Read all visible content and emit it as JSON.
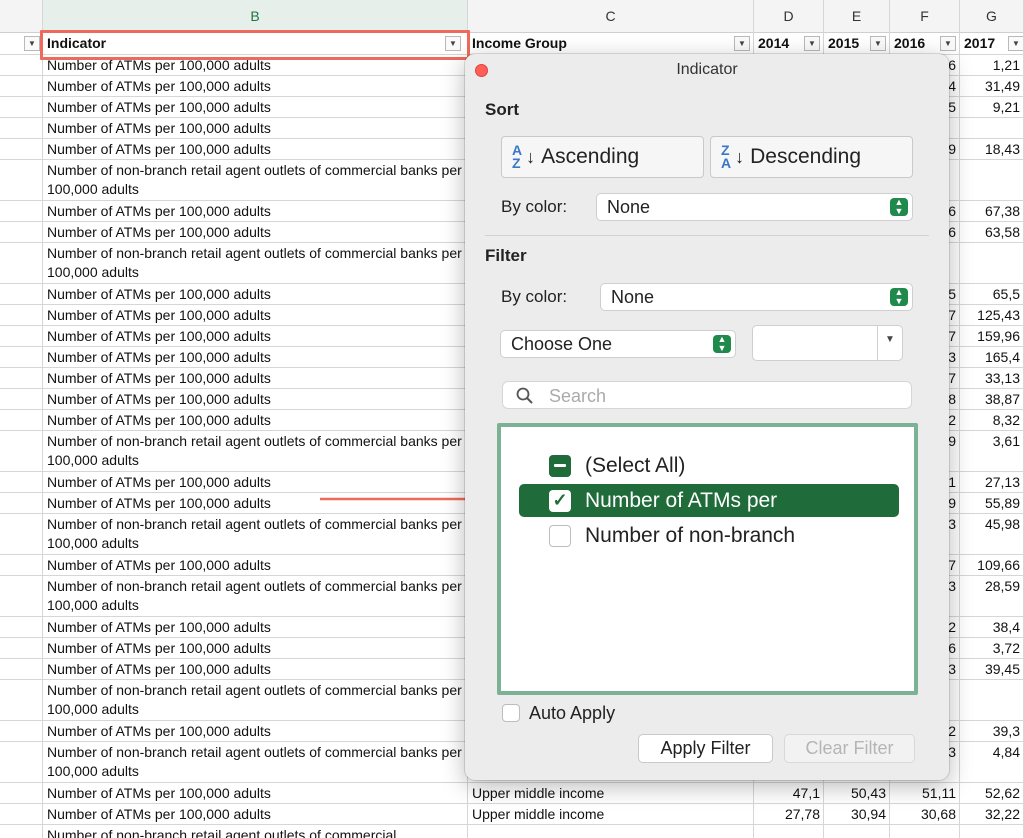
{
  "columns": {
    "b": "B",
    "c": "C",
    "d": "D",
    "e": "E",
    "f": "F",
    "g": "G"
  },
  "headers": {
    "indicator": "Indicator",
    "income_group": "Income Group",
    "y2014": "2014",
    "y2015": "2015",
    "y2016": "2016",
    "y2017": "2017"
  },
  "rows": [
    {
      "b": "Number of ATMs per 100,000 adults",
      "f": "6",
      "g": "1,21"
    },
    {
      "b": "Number of ATMs per 100,000 adults",
      "f": "4",
      "g": "31,49"
    },
    {
      "b": "Number of ATMs per 100,000 adults",
      "f": "5",
      "g": "9,21"
    },
    {
      "b": "Number of ATMs per 100,000 adults",
      "f": "",
      "g": ""
    },
    {
      "b": "Number of ATMs per 100,000 adults",
      "f": "9",
      "g": "18,43"
    },
    {
      "b": "Number of non-branch retail agent outlets of commercial banks per 100,000 adults",
      "f": "",
      "g": ""
    },
    {
      "b": "Number of ATMs per 100,000 adults",
      "f": "6",
      "g": "67,38"
    },
    {
      "b": "Number of ATMs per 100,000 adults",
      "f": "6",
      "g": "63,58"
    },
    {
      "b": "Number of non-branch retail agent outlets of commercial banks per 100,000 adults",
      "f": "",
      "g": ""
    },
    {
      "b": "Number of ATMs per 100,000 adults",
      "f": "5",
      "g": "65,5"
    },
    {
      "b": "Number of ATMs per 100,000 adults",
      "f": "7",
      "g": "125,43"
    },
    {
      "b": "Number of ATMs per 100,000 adults",
      "f": "7",
      "g": "159,96"
    },
    {
      "b": "Number of ATMs per 100,000 adults",
      "f": "3",
      "g": "165,4"
    },
    {
      "b": "Number of ATMs per 100,000 adults",
      "f": "7",
      "g": "33,13"
    },
    {
      "b": "Number of ATMs per 100,000 adults",
      "f": "8",
      "g": "38,87"
    },
    {
      "b": "Number of ATMs per 100,000 adults",
      "f": "2",
      "g": "8,32"
    },
    {
      "b": "Number of non-branch retail agent outlets of commercial banks per 100,000 adults",
      "f": "9",
      "g": "3,61"
    },
    {
      "b": "Number of ATMs per 100,000 adults",
      "f": "1",
      "g": "27,13"
    },
    {
      "b": "Number of ATMs per 100,000 adults",
      "f": "9",
      "g": "55,89"
    },
    {
      "b": "Number of non-branch retail agent outlets of commercial banks per 100,000 adults",
      "f": "3",
      "g": "45,98"
    },
    {
      "b": "Number of ATMs per 100,000 adults",
      "f": "7",
      "g": "109,66"
    },
    {
      "b": "Number of non-branch retail agent outlets of commercial banks per 100,000 adults",
      "f": "3",
      "g": "28,59"
    },
    {
      "b": "Number of ATMs per 100,000 adults",
      "f": "2",
      "g": "38,4"
    },
    {
      "b": "Number of ATMs per 100,000 adults",
      "f": "6",
      "g": "3,72"
    },
    {
      "b": "Number of ATMs per 100,000 adults",
      "f": "3",
      "g": "39,45"
    },
    {
      "b": "Number of non-branch retail agent outlets of commercial banks per 100,000 adults",
      "f": "",
      "g": ""
    },
    {
      "b": "Number of ATMs per 100,000 adults",
      "f": "2",
      "g": "39,3"
    },
    {
      "b": "Number of non-branch retail agent outlets of commercial banks per 100,000 adults",
      "f": "3",
      "g": "4,84"
    },
    {
      "b": "Number of ATMs per 100,000 adults",
      "c": "Upper middle income",
      "d": "47,1",
      "e": "50,43",
      "f": "51,11",
      "g": "52,62"
    },
    {
      "b": "Number of ATMs per 100,000 adults",
      "c": "Upper middle income",
      "d": "27,78",
      "e": "30,94",
      "f": "30,68",
      "g": "32,22"
    },
    {
      "b": "Number of non-branch retail agent outlets of commercial",
      "f": "",
      "g": ""
    }
  ],
  "filter": {
    "title": "Indicator",
    "sort_heading": "Sort",
    "ascending": "Ascending",
    "descending": "Descending",
    "sort_by_color_label": "By color:",
    "sort_by_color_value": "None",
    "filter_heading": "Filter",
    "filter_by_color_label": "By color:",
    "filter_by_color_value": "None",
    "condition_value": "Choose One",
    "condition_input": "",
    "search_placeholder": "Search",
    "items": [
      {
        "label": "(Select All)",
        "state": "mixed",
        "selected": false
      },
      {
        "label": "Number of ATMs per",
        "state": "checked",
        "selected": true
      },
      {
        "label": "Number of non-branch",
        "state": "empty",
        "selected": false
      }
    ],
    "auto_apply": "Auto Apply",
    "apply_button": "Apply Filter",
    "clear_button": "Clear Filter"
  },
  "colors": {
    "accent": "#1f6b3a",
    "highlight": "#ee6a5c",
    "list_border": "#7cb196"
  },
  "icons": [
    "filter-dropdown-icon",
    "search-icon",
    "sort-ascending-icon",
    "sort-descending-icon",
    "stepper-icon",
    "checkmark-icon",
    "red-arrow-icon"
  ]
}
